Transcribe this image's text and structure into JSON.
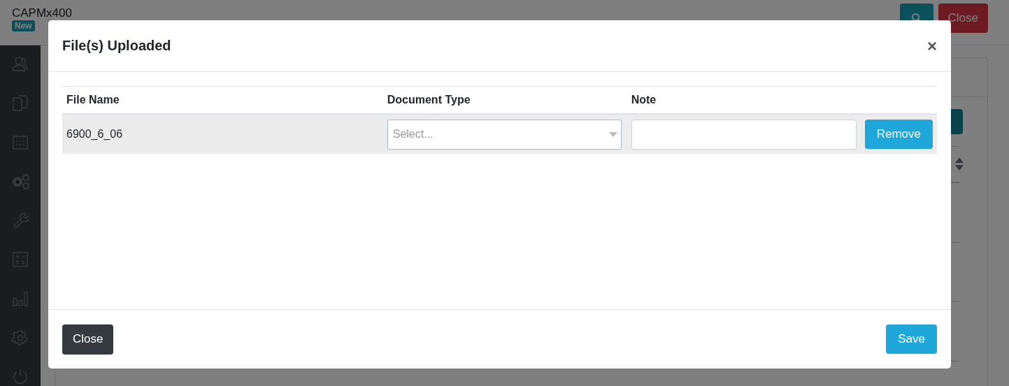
{
  "app": {
    "logo": "CAPMx400",
    "badge": "New",
    "close_button": "Close"
  },
  "modal": {
    "title": "File(s) Uploaded",
    "close_symbol": "×",
    "columns": [
      "File Name",
      "Document Type",
      "Note"
    ],
    "rows": [
      {
        "file_name": "6900_6_06",
        "document_type": {
          "placeholder": "Select..."
        },
        "remove": "Remove"
      }
    ],
    "close": "Close",
    "save": "Save"
  }
}
